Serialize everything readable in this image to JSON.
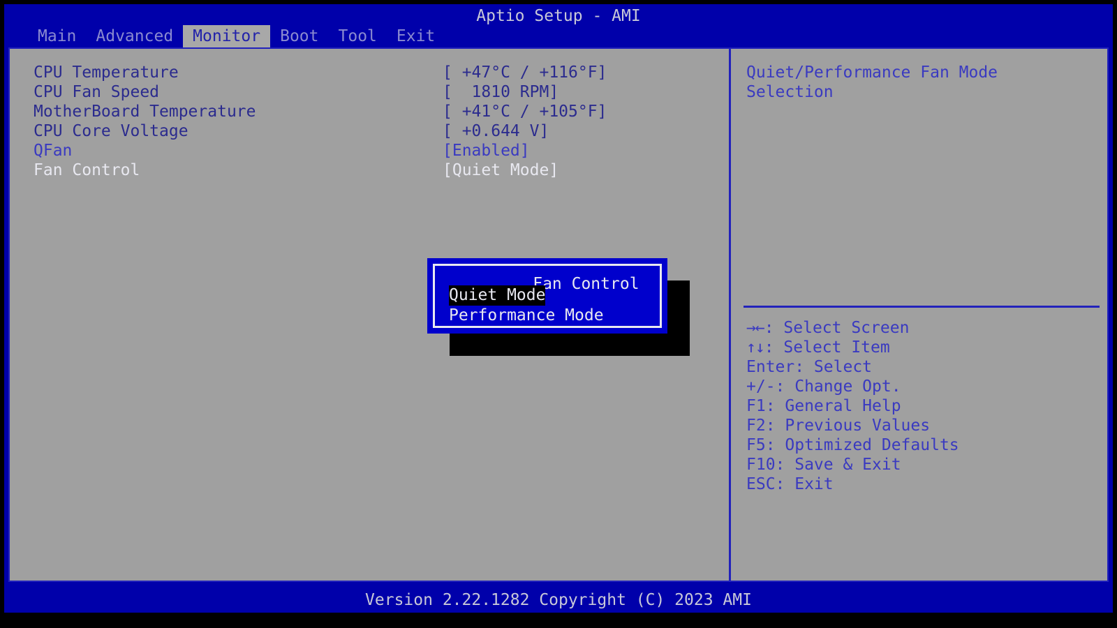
{
  "header": {
    "title": "Aptio Setup - AMI",
    "tabs": [
      {
        "label": "Main",
        "active": false
      },
      {
        "label": "Advanced",
        "active": false
      },
      {
        "label": "Monitor",
        "active": true
      },
      {
        "label": "Boot",
        "active": false
      },
      {
        "label": "Tool",
        "active": false
      },
      {
        "label": "Exit",
        "active": false
      }
    ]
  },
  "settings": {
    "rows": [
      {
        "label": "CPU Temperature",
        "value": "[ +47°C / +116°F]",
        "state": "readonly"
      },
      {
        "label": "CPU Fan Speed",
        "value": "[  1810 RPM]",
        "state": "readonly"
      },
      {
        "label": "MotherBoard Temperature",
        "value": "[ +41°C / +105°F]",
        "state": "readonly"
      },
      {
        "label": "CPU Core Voltage",
        "value": "[ +0.644 V]",
        "state": "readonly"
      },
      {
        "label": "QFan",
        "value": "[Enabled]",
        "state": "normal"
      },
      {
        "label": "Fan Control",
        "value": "[Quiet Mode]",
        "state": "selected"
      }
    ]
  },
  "help": {
    "text": "Quiet/Performance Fan Mode\nSelection",
    "keys": [
      {
        "glyph": "→←",
        "text": ": Select Screen"
      },
      {
        "glyph": "↑↓",
        "text": ": Select Item"
      },
      {
        "glyph": "",
        "text": "Enter: Select"
      },
      {
        "glyph": "",
        "text": "+/-: Change Opt."
      },
      {
        "glyph": "",
        "text": "F1: General Help"
      },
      {
        "glyph": "",
        "text": "F2: Previous Values"
      },
      {
        "glyph": "",
        "text": "F5: Optimized Defaults"
      },
      {
        "glyph": "",
        "text": "F10: Save & Exit"
      },
      {
        "glyph": "",
        "text": "ESC: Exit"
      }
    ]
  },
  "popup": {
    "title": "Fan Control",
    "options": [
      {
        "label": "Quiet Mode",
        "selected": true
      },
      {
        "label": "Performance Mode",
        "selected": false
      }
    ]
  },
  "footer": {
    "version": "Version 2.22.1282 Copyright (C) 2023 AMI"
  },
  "colors": {
    "chrome_blue": "#0000aa",
    "panel_gray": "#a0a0a0",
    "text_blue": "#3a3ac0",
    "text_white": "#e8e8f0",
    "popup_blue": "#0000cc",
    "highlight_black": "#000000"
  }
}
